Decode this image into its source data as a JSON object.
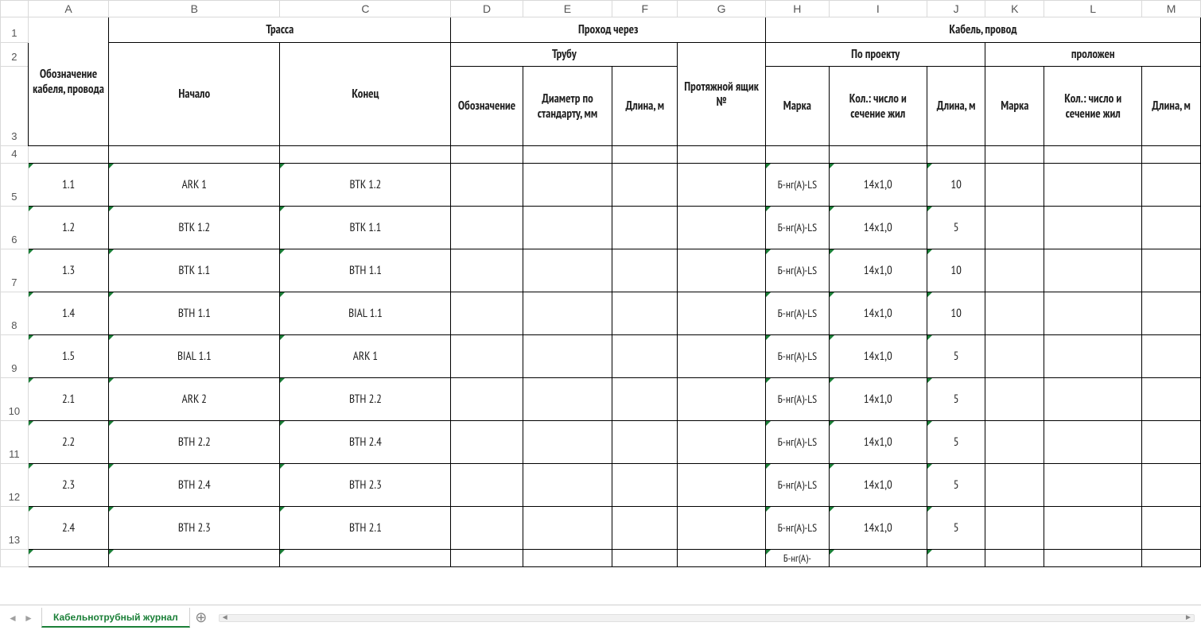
{
  "columns": [
    "A",
    "B",
    "C",
    "D",
    "E",
    "F",
    "G",
    "H",
    "I",
    "J",
    "K",
    "L",
    "M"
  ],
  "rowNumbers": [
    "1",
    "2",
    "3",
    "4",
    "5",
    "6",
    "7",
    "8",
    "9",
    "10",
    "11",
    "12",
    "13"
  ],
  "headers": {
    "A_designation": "Обозначение кабеля, провода",
    "route": "Трасса",
    "route_start": "Начало",
    "route_end": "Конец",
    "passage": "Проход через",
    "pipe": "Трубу",
    "pipe_designation": "Обозначение",
    "pipe_diameter": "Диаметр по стандарту, мм",
    "pipe_length": "Длина, м",
    "junction_box": "Протяжной ящик №",
    "cable_wire": "Кабель, провод",
    "by_project": "По проекту",
    "laid": "проложен",
    "brand": "Марка",
    "count_section": "Кол.: число и сечение жил",
    "length_m": "Длина, м"
  },
  "rows": [
    {
      "id": "1.1",
      "start": "ARK 1",
      "end": "BTK 1.2",
      "brand": "Б-нг(А)-LS",
      "cs": "14х1,0",
      "len": "10"
    },
    {
      "id": "1.2",
      "start": "BTK 1.2",
      "end": "BTK 1.1",
      "brand": "Б-нг(А)-LS",
      "cs": "14х1,0",
      "len": "5"
    },
    {
      "id": "1.3",
      "start": "BTK 1.1",
      "end": "BTH 1.1",
      "brand": "Б-нг(А)-LS",
      "cs": "14х1,0",
      "len": "10"
    },
    {
      "id": "1.4",
      "start": "BTH 1.1",
      "end": "BIAL 1.1",
      "brand": "Б-нг(А)-LS",
      "cs": "14х1,0",
      "len": "10"
    },
    {
      "id": "1.5",
      "start": "BIAL 1.1",
      "end": "ARK 1",
      "brand": "Б-нг(А)-LS",
      "cs": "14х1,0",
      "len": "5"
    },
    {
      "id": "2.1",
      "start": "ARK 2",
      "end": "BTH 2.2",
      "brand": "Б-нг(А)-LS",
      "cs": "14х1,0",
      "len": "5"
    },
    {
      "id": "2.2",
      "start": "BTH 2.2",
      "end": "BTH 2.4",
      "brand": "Б-нг(А)-LS",
      "cs": "14х1,0",
      "len": "5"
    },
    {
      "id": "2.3",
      "start": "BTH 2.4",
      "end": "BTH 2.3",
      "brand": "Б-нг(А)-LS",
      "cs": "14х1,0",
      "len": "5"
    },
    {
      "id": "2.4",
      "start": "BTH 2.3",
      "end": "BTH 2.1",
      "brand": "Б-нг(А)-LS",
      "cs": "14х1,0",
      "len": "5"
    }
  ],
  "partialRow": {
    "brand": "Б-нг(А)-"
  },
  "sheetTab": "Кабельнотрубный журнал"
}
